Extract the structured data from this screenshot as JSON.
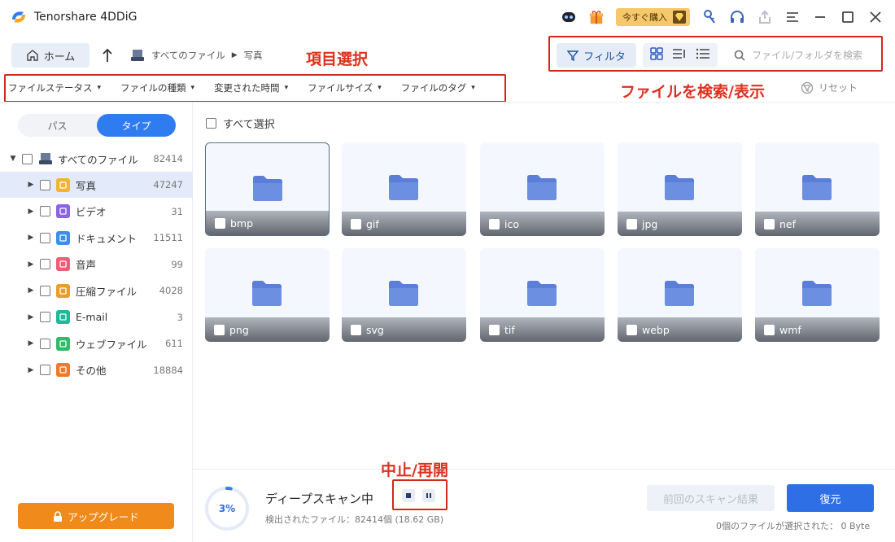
{
  "app": {
    "title": "Tenorshare 4DDiG"
  },
  "titlebar": {
    "buy_now_label": "今すぐ購入"
  },
  "toolbar": {
    "home_label": "ホーム",
    "breadcrumb": [
      "すべてのファイル",
      "写真"
    ],
    "filter_label": "フィルタ",
    "search_placeholder": "ファイル/フォルダを検索"
  },
  "annotations": {
    "item_select": "項目選択",
    "search_display": "ファイルを検索/表示",
    "pause_resume": "中止/再開"
  },
  "filters": {
    "items": [
      "ファイルステータス",
      "ファイルの種類",
      "変更された時間",
      "ファイルサイズ",
      "ファイルのタグ"
    ],
    "reset_label": "リセット"
  },
  "sidebar": {
    "tabs": [
      "パス",
      "タイプ"
    ],
    "active_tab": "タイプ",
    "root": {
      "label": "すべてのファイル",
      "count": "82414"
    },
    "items": [
      {
        "label": "写真",
        "count": "47247",
        "color": "#f3b431",
        "icon": "photo-icon"
      },
      {
        "label": "ビデオ",
        "count": "31",
        "color": "#8a63e6",
        "icon": "video-icon"
      },
      {
        "label": "ドキュメント",
        "count": "11511",
        "color": "#3b8fe9",
        "icon": "document-icon"
      },
      {
        "label": "音声",
        "count": "99",
        "color": "#ef5d77",
        "icon": "audio-icon"
      },
      {
        "label": "圧縮ファイル",
        "count": "4028",
        "color": "#e99e2b",
        "icon": "archive-icon"
      },
      {
        "label": "E-mail",
        "count": "3",
        "color": "#20b79a",
        "icon": "email-icon"
      },
      {
        "label": "ウェブファイル",
        "count": "611",
        "color": "#35b86a",
        "icon": "web-icon"
      },
      {
        "label": "その他",
        "count": "18884",
        "color": "#f07a2a",
        "icon": "other-icon"
      }
    ],
    "upgrade_label": "アップグレード"
  },
  "main": {
    "select_all_label": "すべて選択",
    "folders": [
      "bmp",
      "gif",
      "ico",
      "jpg",
      "nef",
      "png",
      "svg",
      "tif",
      "webp",
      "wmf"
    ]
  },
  "status": {
    "progress_text": "3%",
    "progress_value": 0.03,
    "title": "ディープスキャン中",
    "detected": "検出されたファイル：82414個 (18.62 GB)",
    "prev_results_label": "前回のスキャン結果",
    "restore_label": "復元",
    "selected_info": "0個のファイルが選択された： 0 Byte"
  },
  "colors": {
    "accent": "#2f6fe6",
    "annotation": "#e0301e",
    "folder": "#5b7fd8",
    "upgrade": "#f08a1a"
  }
}
